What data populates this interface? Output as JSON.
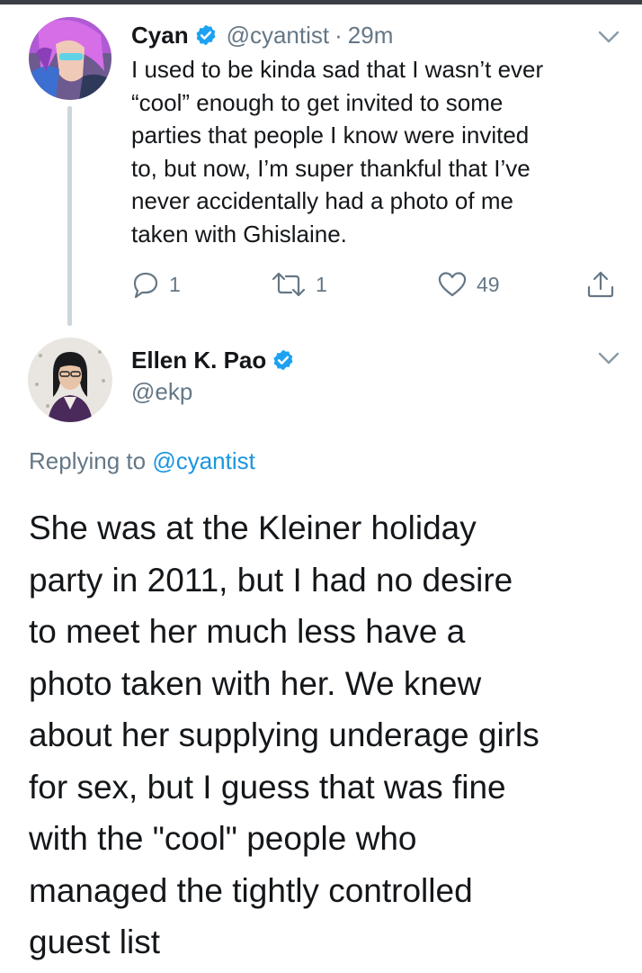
{
  "thread_parent": {
    "author_name": "Cyan",
    "handle": "@cyantist",
    "separator": "·",
    "time": "29m",
    "text": "I used to be kinda sad that I wasn’t ever\n“cool” enough to get invited to some\nparties that people I know were invited\nto, but now, I’m super thankful that I’ve\nnever accidentally had a photo of me\ntaken with Ghislaine.",
    "actions": {
      "reply_count": "1",
      "retweet_count": "1",
      "like_count": "49"
    }
  },
  "focused_tweet": {
    "author_name": "Ellen K. Pao",
    "handle": "@ekp",
    "replying_prefix": "Replying to",
    "replying_to": "@cyantist",
    "text": "She was at the Kleiner holiday\nparty in 2011, but I had no desire\nto meet her much less have a\nphoto taken with her. We knew\nabout her supplying underage girls\nfor sex, but I guess that was fine\nwith the \"cool\" people who\nmanaged the tightly controlled\nguest list"
  },
  "icons": {
    "verified": "verified-badge-icon",
    "menu": "chevron-down-icon",
    "reply": "reply-icon",
    "retweet": "retweet-icon",
    "like": "heart-icon",
    "share": "share-icon"
  },
  "colors": {
    "text_primary": "#14171a",
    "text_secondary": "#657786",
    "link_blue": "#1b95e0",
    "verified_blue": "#1da1f2",
    "thread_line": "#cdd6dd"
  }
}
